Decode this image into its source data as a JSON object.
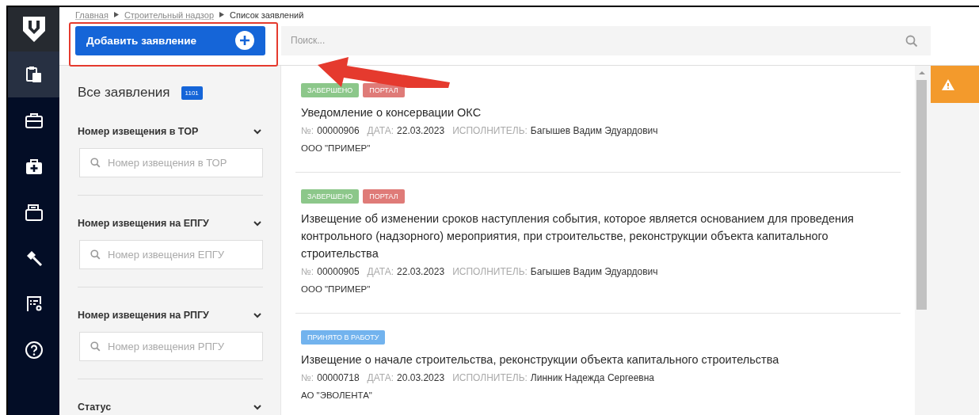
{
  "sidebar": {
    "items": [
      {
        "kind": "clipboards",
        "selected": true
      },
      {
        "kind": "briefcase",
        "selected": false
      },
      {
        "kind": "medkit",
        "selected": false
      },
      {
        "kind": "folder",
        "selected": false
      },
      {
        "kind": "hammer",
        "selected": false
      },
      {
        "kind": "checklist",
        "selected": false
      },
      {
        "kind": "help",
        "selected": false
      }
    ]
  },
  "breadcrumbs": [
    {
      "label": "Главная",
      "current": false
    },
    {
      "label": "Строительный надзор",
      "current": false
    },
    {
      "label": "Список заявлений",
      "current": true
    }
  ],
  "add_button": {
    "label": "Добавить заявление"
  },
  "search": {
    "placeholder": "Поиск..."
  },
  "filters_panel": {
    "title": "Все заявления",
    "count": "1101",
    "filters": [
      {
        "label": "Номер извещения в ТОР",
        "placeholder": "Номер извещения в ТОР"
      },
      {
        "label": "Номер извещения на ЕПГУ",
        "placeholder": "Номер извещения ЕПГУ"
      },
      {
        "label": "Номер извещения на РПГУ",
        "placeholder": "Номер извещения РПГУ"
      },
      {
        "label": "Статус"
      }
    ]
  },
  "applications": [
    {
      "tags": [
        {
          "label": "ЗАВЕРШЕНО",
          "color": "#8cc78a"
        },
        {
          "label": "ПОРТАЛ",
          "color": "#df7b78"
        }
      ],
      "title": "Уведомление о консервации ОКС",
      "number_label": "№:",
      "number": "00000906",
      "date_label": "ДАТА:",
      "date": "22.03.2023",
      "executor_label": "ИСПОЛНИТЕЛЬ:",
      "executor": "Багышев Вадим Эдуардович",
      "organization": "ООО \"ПРИМЕР\""
    },
    {
      "tags": [
        {
          "label": "ЗАВЕРШЕНО",
          "color": "#8cc78a"
        },
        {
          "label": "ПОРТАЛ",
          "color": "#df7b78"
        }
      ],
      "title": "Извещение об изменении сроков наступления события, которое является основанием для проведения контрольного (надзорного) мероприятия, при строительстве, реконструкции объекта капитального строительства",
      "number_label": "№:",
      "number": "00000905",
      "date_label": "ДАТА:",
      "date": "22.03.2023",
      "executor_label": "ИСПОЛНИТЕЛЬ:",
      "executor": "Багышев Вадим Эдуардович",
      "organization": "ООО \"ПРИМЕР\""
    },
    {
      "tags": [
        {
          "label": "ПРИНЯТО В РАБОТУ",
          "color": "#72b3ee"
        }
      ],
      "title": "Извещение о начале строительства, реконструкции объекта капитального строительства",
      "number_label": "№:",
      "number": "00000718",
      "date_label": "ДАТА:",
      "date": "20.03.2023",
      "executor_label": "ИСПОЛНИТЕЛЬ:",
      "executor": "Линник Надежда Сергеевна",
      "organization": "АО \"ЭВОЛЕНТА\""
    }
  ],
  "notification_panel": {
    "kind": "warning"
  }
}
